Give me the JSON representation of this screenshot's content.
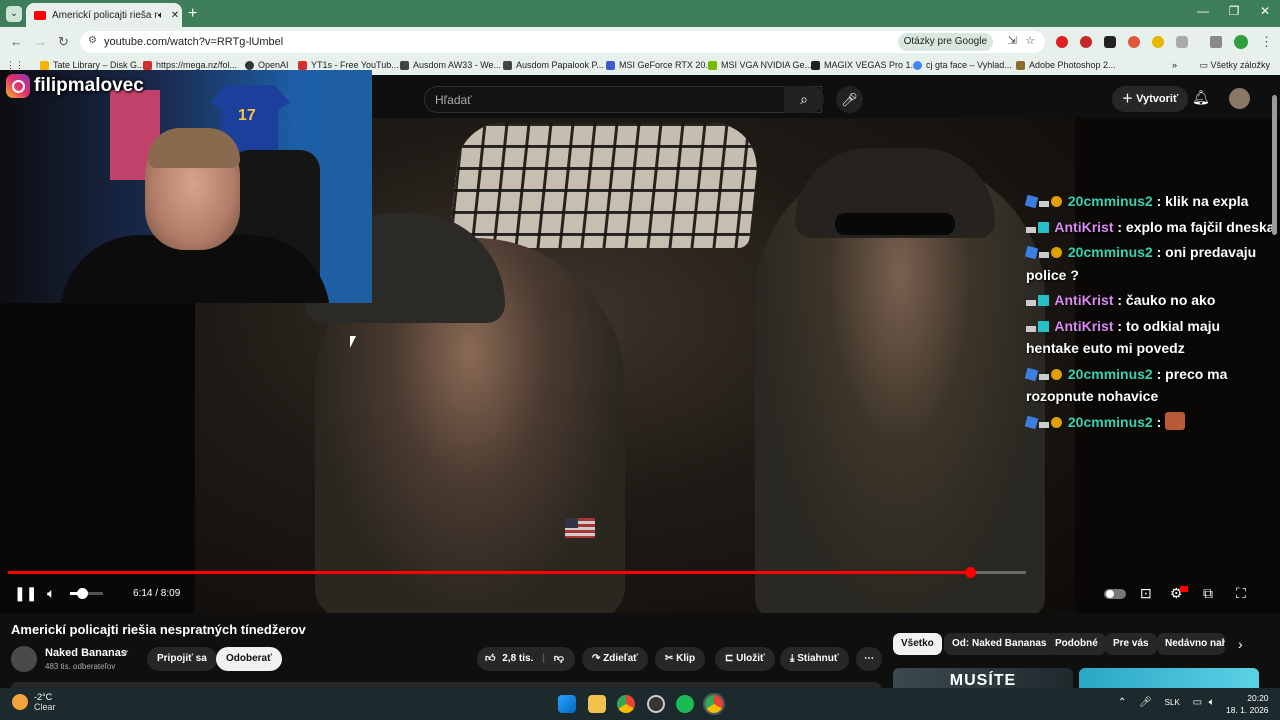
{
  "browser": {
    "tab_title": "Americkí policajti rieša nesp",
    "url": "youtube.com/watch?v=RRTg-lUmbel",
    "google_q": "Otázky pre Google",
    "bookmarks": [
      "Tate Library – Disk G...",
      "https://mega.nz/fol...",
      "OpenAI",
      "YT1s - Free YouTub...",
      "Ausdom AW33 - We...",
      "Ausdom Papalook P...",
      "MSI GeForce RTX 20...",
      "MSI VGA NVIDIA Ge...",
      "MAGIX VEGAS Pro 1...",
      "cj gta face – Vyhlad...",
      "Adobe Photoshop 2..."
    ],
    "all_bookmarks": "Všetky záložky"
  },
  "overlay": {
    "instagram": "filipmalovec"
  },
  "header": {
    "search_placeholder": "Hľadať",
    "create_label": "Vytvoriť"
  },
  "chat": [
    {
      "user": "20cmminus2",
      "text": ": klik na expla",
      "style": "u1",
      "badges": [
        "cube",
        "sub",
        "coin"
      ]
    },
    {
      "user": "AntiKrist",
      "text": ": explo ma fajčil dneska",
      "style": "u2",
      "badges": [
        "sub",
        "alt"
      ]
    },
    {
      "user": "20cmminus2",
      "text": ": oni predavaju police ?",
      "style": "u1",
      "badges": [
        "cube",
        "sub",
        "coin"
      ]
    },
    {
      "user": "AntiKrist",
      "text": ": čauko no ako",
      "style": "u2",
      "badges": [
        "sub",
        "alt"
      ]
    },
    {
      "user": "AntiKrist",
      "text": ": to odkial maju hentake euto mi povedz",
      "style": "u2",
      "badges": [
        "sub",
        "alt"
      ]
    },
    {
      "user": "20cmminus2",
      "text": ": preco ma rozopnute nohavice",
      "style": "u1",
      "badges": [
        "cube",
        "sub",
        "coin"
      ]
    },
    {
      "user": "20cmminus2",
      "text": ":",
      "style": "u1",
      "badges": [
        "cube",
        "sub",
        "coin"
      ],
      "emote": true
    }
  ],
  "player": {
    "time": "6:14 / 8:09",
    "progress": 0.3757,
    "played": 0.945,
    "volume": 0.35
  },
  "video": {
    "title": "Americkí policajti riešia nespratných tínedžerov",
    "channel": "Naked Bananas",
    "subscribers": "483 tis. odberateľov",
    "join_label": "Pripojiť sa",
    "subscribe_label": "Odoberať",
    "likes": "2,8 tis.",
    "share_label": "Zdieľať",
    "clip_label": "Klip",
    "save_label": "Uložiť",
    "download_label": "Stiahnuť"
  },
  "chips": [
    "Všetko",
    "Od: Naked Bananas",
    "Podobné",
    "Pre vás",
    "Nedávno nahr"
  ],
  "thumb1_text": "MUSÍTE",
  "taskbar": {
    "temp": "-2°C",
    "condition": "Clear",
    "lang": "SLK",
    "time": "20:20",
    "date": "18. 1. 2026"
  },
  "colors": {
    "youtube_red": "#ff0000",
    "chrome_green": "#3d7d5a",
    "chat_user_1": "#39d2b0",
    "chat_user_2": "#d68bf2"
  }
}
